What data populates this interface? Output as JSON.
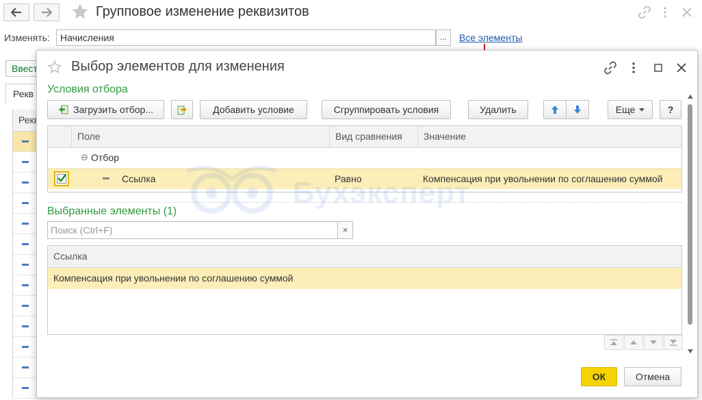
{
  "main": {
    "title": "Групповое изменение реквизитов",
    "change_label": "Изменять:",
    "change_value": "Начисления",
    "dots": "...",
    "all_elements_link": "Все элементы",
    "bg_button_label": "Ввест",
    "bg_tab_label": "Рекв",
    "bg_table_header": "Рекв"
  },
  "dialog": {
    "title": "Выбор элементов для изменения",
    "filter_section_title": "Условия отбора",
    "toolbar": {
      "load_filter": "Загрузить отбор...",
      "add_condition": "Добавить условие",
      "group_conditions": "Сгруппировать условия",
      "delete": "Удалить",
      "more": "Еще",
      "help": "?"
    },
    "filter_table": {
      "columns": [
        "Поле",
        "Вид сравнения",
        "Значение"
      ],
      "group_row": "Отбор",
      "row": {
        "field": "Ссылка",
        "comparison": "Равно",
        "value": "Компенсация при увольнении по соглашению суммой"
      }
    },
    "selected_section_title": "Выбранные элементы (1)",
    "search_placeholder": "Поиск (Ctrl+F)",
    "search_clear": "×",
    "selected_table": {
      "column": "Ссылка",
      "rows": [
        "Компенсация при увольнении по соглашению суммой"
      ]
    },
    "ok_label": "ОК",
    "cancel_label": "Отмена"
  },
  "watermark_text": "Бухэксперт",
  "colors": {
    "accent_green": "#2f9a3e",
    "selection_yellow": "#fbeeb8",
    "ok_yellow": "#f5d300",
    "link_blue": "#1e5aa8"
  }
}
